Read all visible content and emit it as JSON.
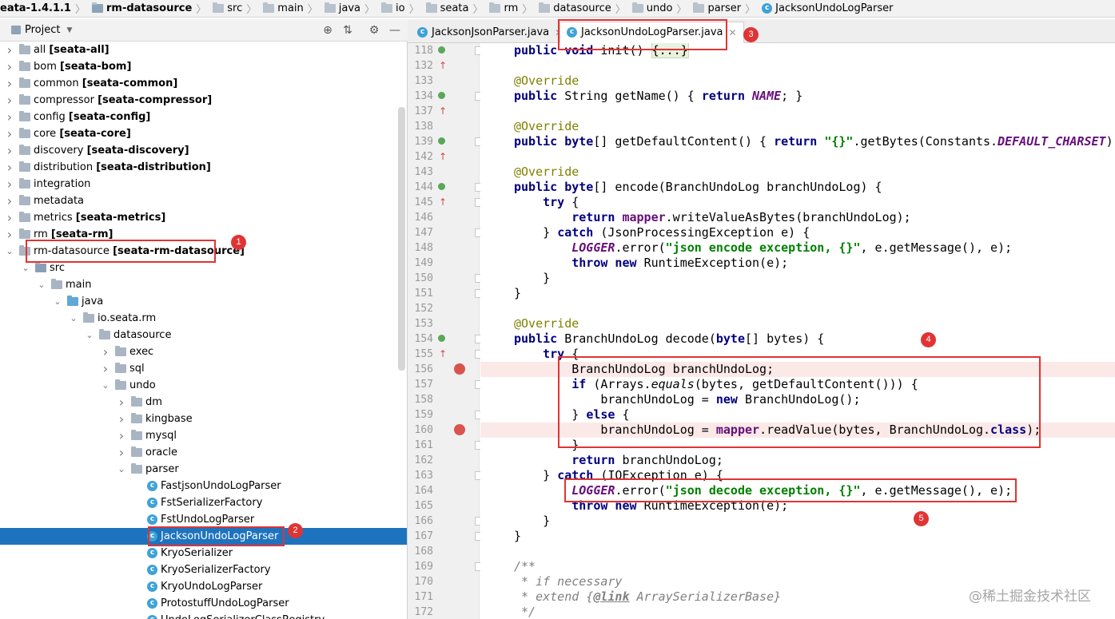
{
  "breadcrumb": [
    {
      "label": "eata-1.4.1.1",
      "bold": true,
      "icon": "folder-icon"
    },
    {
      "label": "rm-datasource",
      "bold": true,
      "icon": "module-folder-icon"
    },
    {
      "label": "src",
      "bold": false,
      "icon": "folder-icon"
    },
    {
      "label": "main",
      "bold": false,
      "icon": "folder-icon"
    },
    {
      "label": "java",
      "bold": false,
      "icon": "folder-icon"
    },
    {
      "label": "io",
      "bold": false,
      "icon": "folder-icon"
    },
    {
      "label": "seata",
      "bold": false,
      "icon": "folder-icon"
    },
    {
      "label": "rm",
      "bold": false,
      "icon": "folder-icon"
    },
    {
      "label": "datasource",
      "bold": false,
      "icon": "folder-icon"
    },
    {
      "label": "undo",
      "bold": false,
      "icon": "folder-icon"
    },
    {
      "label": "parser",
      "bold": false,
      "icon": "folder-icon"
    },
    {
      "label": "JacksonUndoLogParser",
      "bold": false,
      "icon": "class-icon"
    }
  ],
  "project_panel": {
    "title": "Project",
    "tree": [
      {
        "depth": 0,
        "arrow": "right",
        "icon": "module",
        "name": "all",
        "module": "[seata-all]"
      },
      {
        "depth": 0,
        "arrow": "right",
        "icon": "module",
        "name": "bom",
        "module": "[seata-bom]"
      },
      {
        "depth": 0,
        "arrow": "right",
        "icon": "module",
        "name": "common",
        "module": "[seata-common]"
      },
      {
        "depth": 0,
        "arrow": "right",
        "icon": "module",
        "name": "compressor",
        "module": "[seata-compressor]"
      },
      {
        "depth": 0,
        "arrow": "right",
        "icon": "module",
        "name": "config",
        "module": "[seata-config]"
      },
      {
        "depth": 0,
        "arrow": "right",
        "icon": "module",
        "name": "core",
        "module": "[seata-core]"
      },
      {
        "depth": 0,
        "arrow": "right",
        "icon": "module",
        "name": "discovery",
        "module": "[seata-discovery]"
      },
      {
        "depth": 0,
        "arrow": "right",
        "icon": "module",
        "name": "distribution",
        "module": "[seata-distribution]"
      },
      {
        "depth": 0,
        "arrow": "right",
        "icon": "folder",
        "name": "integration",
        "module": ""
      },
      {
        "depth": 0,
        "arrow": "right",
        "icon": "folder",
        "name": "metadata",
        "module": ""
      },
      {
        "depth": 0,
        "arrow": "right",
        "icon": "module",
        "name": "metrics",
        "module": "[seata-metrics]"
      },
      {
        "depth": 0,
        "arrow": "right",
        "icon": "module",
        "name": "rm",
        "module": "[seata-rm]"
      },
      {
        "depth": 0,
        "arrow": "down",
        "icon": "module",
        "name": "rm-datasource",
        "module": "[seata-rm-datasource]"
      },
      {
        "depth": 1,
        "arrow": "down",
        "icon": "src",
        "name": "src",
        "module": ""
      },
      {
        "depth": 2,
        "arrow": "down",
        "icon": "folder",
        "name": "main",
        "module": ""
      },
      {
        "depth": 3,
        "arrow": "down",
        "icon": "java",
        "name": "java",
        "module": ""
      },
      {
        "depth": 4,
        "arrow": "down",
        "icon": "pkg",
        "name": "io.seata.rm",
        "module": ""
      },
      {
        "depth": 5,
        "arrow": "down",
        "icon": "pkg",
        "name": "datasource",
        "module": ""
      },
      {
        "depth": 6,
        "arrow": "right",
        "icon": "pkg",
        "name": "exec",
        "module": ""
      },
      {
        "depth": 6,
        "arrow": "right",
        "icon": "pkg",
        "name": "sql",
        "module": ""
      },
      {
        "depth": 6,
        "arrow": "down",
        "icon": "pkg",
        "name": "undo",
        "module": ""
      },
      {
        "depth": 7,
        "arrow": "right",
        "icon": "pkg",
        "name": "dm",
        "module": ""
      },
      {
        "depth": 7,
        "arrow": "right",
        "icon": "pkg",
        "name": "kingbase",
        "module": ""
      },
      {
        "depth": 7,
        "arrow": "right",
        "icon": "pkg",
        "name": "mysql",
        "module": ""
      },
      {
        "depth": 7,
        "arrow": "right",
        "icon": "pkg",
        "name": "oracle",
        "module": ""
      },
      {
        "depth": 7,
        "arrow": "down",
        "icon": "pkg",
        "name": "parser",
        "module": ""
      },
      {
        "depth": 8,
        "arrow": "none",
        "icon": "class",
        "name": "FastjsonUndoLogParser",
        "module": ""
      },
      {
        "depth": 8,
        "arrow": "none",
        "icon": "class",
        "name": "FstSerializerFactory",
        "module": ""
      },
      {
        "depth": 8,
        "arrow": "none",
        "icon": "class",
        "name": "FstUndoLogParser",
        "module": ""
      },
      {
        "depth": 8,
        "arrow": "none",
        "icon": "class",
        "name": "JacksonUndoLogParser",
        "module": "",
        "selected": true
      },
      {
        "depth": 8,
        "arrow": "none",
        "icon": "class",
        "name": "KryoSerializer",
        "module": ""
      },
      {
        "depth": 8,
        "arrow": "none",
        "icon": "class",
        "name": "KryoSerializerFactory",
        "module": ""
      },
      {
        "depth": 8,
        "arrow": "none",
        "icon": "class",
        "name": "KryoUndoLogParser",
        "module": ""
      },
      {
        "depth": 8,
        "arrow": "none",
        "icon": "class",
        "name": "ProtostuffUndoLogParser",
        "module": ""
      },
      {
        "depth": 8,
        "arrow": "none",
        "icon": "class",
        "name": "UndoLogSerializerClassRegistry",
        "module": ""
      }
    ]
  },
  "editor": {
    "tabs": [
      {
        "label": "JacksonJsonParser.java",
        "active": false
      },
      {
        "label": "JacksonUndoLogParser.java",
        "active": true
      }
    ],
    "lines": [
      {
        "n": "118",
        "impl": true,
        "bp": false,
        "fold": true,
        "code": [
          [
            "kw",
            "public "
          ],
          [
            "kw",
            "void "
          ],
          [
            "pl",
            "init() "
          ],
          [
            "fold",
            "{...}"
          ]
        ]
      },
      {
        "n": "132",
        "impl": false,
        "bp": false,
        "fold": false,
        "code": []
      },
      {
        "n": "133",
        "impl": false,
        "bp": false,
        "fold": false,
        "code": [
          [
            "an",
            "@Override"
          ]
        ]
      },
      {
        "n": "134",
        "impl": true,
        "bp": false,
        "fold": true,
        "code": [
          [
            "kw",
            "public "
          ],
          [
            "pl",
            "String getName() { "
          ],
          [
            "kw",
            "return "
          ],
          [
            "const",
            "NAME"
          ],
          [
            "pl",
            "; }"
          ]
        ]
      },
      {
        "n": "137",
        "impl": false,
        "bp": false,
        "fold": false,
        "code": []
      },
      {
        "n": "138",
        "impl": false,
        "bp": false,
        "fold": false,
        "code": [
          [
            "an",
            "@Override"
          ]
        ]
      },
      {
        "n": "139",
        "impl": true,
        "bp": false,
        "fold": true,
        "code": [
          [
            "kw",
            "public byte"
          ],
          [
            "pl",
            "[] getDefaultContent() { "
          ],
          [
            "kw",
            "return "
          ],
          [
            "str",
            "\"{}\""
          ],
          [
            "pl",
            ".getBytes(Constants."
          ],
          [
            "const",
            "DEFAULT_CHARSET"
          ],
          [
            "pl",
            ");"
          ]
        ]
      },
      {
        "n": "142",
        "impl": false,
        "bp": false,
        "fold": false,
        "code": []
      },
      {
        "n": "143",
        "impl": false,
        "bp": false,
        "fold": false,
        "code": [
          [
            "an",
            "@Override"
          ]
        ]
      },
      {
        "n": "144",
        "impl": true,
        "bp": false,
        "fold": true,
        "code": [
          [
            "kw",
            "public byte"
          ],
          [
            "pl",
            "[] encode(BranchUndoLog branchUndoLog) {"
          ]
        ]
      },
      {
        "n": "145",
        "impl": false,
        "bp": false,
        "fold": true,
        "code": [
          [
            "pl",
            "    "
          ],
          [
            "kw",
            "try "
          ],
          [
            "pl",
            "{"
          ]
        ]
      },
      {
        "n": "146",
        "impl": false,
        "bp": false,
        "fold": false,
        "code": [
          [
            "pl",
            "        "
          ],
          [
            "kw",
            "return "
          ],
          [
            "field",
            "mapper"
          ],
          [
            "pl",
            ".writeValueAsBytes(branchUndoLog);"
          ]
        ]
      },
      {
        "n": "147",
        "impl": false,
        "bp": false,
        "fold": true,
        "code": [
          [
            "pl",
            "    } "
          ],
          [
            "kw",
            "catch "
          ],
          [
            "pl",
            "(JsonProcessingException e) {"
          ]
        ]
      },
      {
        "n": "148",
        "impl": false,
        "bp": false,
        "fold": false,
        "code": [
          [
            "pl",
            "        "
          ],
          [
            "const",
            "LOGGER"
          ],
          [
            "pl",
            ".error("
          ],
          [
            "str",
            "\"json encode exception, {}\""
          ],
          [
            "pl",
            ", e.getMessage(), e);"
          ]
        ]
      },
      {
        "n": "149",
        "impl": false,
        "bp": false,
        "fold": false,
        "code": [
          [
            "pl",
            "        "
          ],
          [
            "kw",
            "throw new "
          ],
          [
            "pl",
            "RuntimeException(e);"
          ]
        ]
      },
      {
        "n": "150",
        "impl": false,
        "bp": false,
        "fold": true,
        "code": [
          [
            "pl",
            "    }"
          ]
        ]
      },
      {
        "n": "151",
        "impl": false,
        "bp": false,
        "fold": true,
        "code": [
          [
            "pl",
            "}"
          ]
        ]
      },
      {
        "n": "152",
        "impl": false,
        "bp": false,
        "fold": false,
        "code": []
      },
      {
        "n": "153",
        "impl": false,
        "bp": false,
        "fold": false,
        "code": [
          [
            "an",
            "@Override"
          ]
        ]
      },
      {
        "n": "154",
        "impl": true,
        "bp": false,
        "fold": true,
        "code": [
          [
            "kw",
            "public "
          ],
          [
            "pl",
            "BranchUndoLog decode("
          ],
          [
            "kw",
            "byte"
          ],
          [
            "pl",
            "[] bytes) {"
          ]
        ]
      },
      {
        "n": "155",
        "impl": false,
        "bp": false,
        "fold": true,
        "code": [
          [
            "pl",
            "    "
          ],
          [
            "kw",
            "try "
          ],
          [
            "pl",
            "{"
          ]
        ]
      },
      {
        "n": "156",
        "impl": false,
        "bp": true,
        "fold": false,
        "code": [
          [
            "pl",
            "        BranchUndoLog branchUndoLog;"
          ]
        ]
      },
      {
        "n": "157",
        "impl": false,
        "bp": false,
        "fold": true,
        "code": [
          [
            "pl",
            "        "
          ],
          [
            "kw",
            "if "
          ],
          [
            "pl",
            "(Arrays."
          ],
          [
            "static",
            "equals"
          ],
          [
            "pl",
            "(bytes, getDefaultContent())) {"
          ]
        ]
      },
      {
        "n": "158",
        "impl": false,
        "bp": false,
        "fold": false,
        "code": [
          [
            "pl",
            "            branchUndoLog = "
          ],
          [
            "kw",
            "new "
          ],
          [
            "pl",
            "BranchUndoLog();"
          ]
        ]
      },
      {
        "n": "159",
        "impl": false,
        "bp": false,
        "fold": true,
        "code": [
          [
            "pl",
            "        } "
          ],
          [
            "kw",
            "else "
          ],
          [
            "pl",
            "{"
          ]
        ]
      },
      {
        "n": "160",
        "impl": false,
        "bp": true,
        "fold": false,
        "code": [
          [
            "pl",
            "            branchUndoLog = "
          ],
          [
            "field",
            "mapper"
          ],
          [
            "pl",
            ".readValue(bytes, BranchUndoLog."
          ],
          [
            "kw",
            "class"
          ],
          [
            "pl",
            ");"
          ]
        ]
      },
      {
        "n": "161",
        "impl": false,
        "bp": false,
        "fold": true,
        "code": [
          [
            "pl",
            "        }"
          ]
        ]
      },
      {
        "n": "162",
        "impl": false,
        "bp": false,
        "fold": false,
        "code": [
          [
            "pl",
            "        "
          ],
          [
            "kw",
            "return "
          ],
          [
            "pl",
            "branchUndoLog;"
          ]
        ]
      },
      {
        "n": "163",
        "impl": false,
        "bp": false,
        "fold": true,
        "code": [
          [
            "pl",
            "    } "
          ],
          [
            "kw",
            "catch "
          ],
          [
            "pl",
            "(IOException e) {"
          ]
        ]
      },
      {
        "n": "164",
        "impl": false,
        "bp": false,
        "fold": false,
        "code": [
          [
            "pl",
            "        "
          ],
          [
            "const",
            "LOGGER"
          ],
          [
            "pl",
            ".error("
          ],
          [
            "str",
            "\"json decode exception, {}\""
          ],
          [
            "pl",
            ", e.getMessage(), e);"
          ]
        ]
      },
      {
        "n": "165",
        "impl": false,
        "bp": false,
        "fold": false,
        "code": [
          [
            "pl",
            "        "
          ],
          [
            "kw",
            "throw new "
          ],
          [
            "pl",
            "RuntimeException(e);"
          ]
        ]
      },
      {
        "n": "166",
        "impl": false,
        "bp": false,
        "fold": true,
        "code": [
          [
            "pl",
            "    }"
          ]
        ]
      },
      {
        "n": "167",
        "impl": false,
        "bp": false,
        "fold": true,
        "code": [
          [
            "pl",
            "}"
          ]
        ]
      },
      {
        "n": "168",
        "impl": false,
        "bp": false,
        "fold": false,
        "code": []
      },
      {
        "n": "169",
        "impl": false,
        "bp": false,
        "fold": true,
        "code": [
          [
            "cm",
            "/**"
          ]
        ]
      },
      {
        "n": "170",
        "impl": false,
        "bp": false,
        "fold": false,
        "code": [
          [
            "cm",
            " * if necessary"
          ]
        ]
      },
      {
        "n": "171",
        "impl": false,
        "bp": false,
        "fold": false,
        "code": [
          [
            "cm",
            " * extend {"
          ],
          [
            "cmtag",
            "@link"
          ],
          [
            "cm",
            " ArraySerializerBase}"
          ]
        ]
      },
      {
        "n": "172",
        "impl": false,
        "bp": false,
        "fold": false,
        "code": [
          [
            "cm",
            " */"
          ]
        ]
      }
    ]
  },
  "annotations": [
    "1",
    "2",
    "3",
    "4",
    "5"
  ],
  "watermark": "@稀土掘金技术社区",
  "colors": {
    "keyword": "#000080",
    "string": "#008000",
    "annotation": "#808000",
    "constant": "#660e7a",
    "comment": "#808080",
    "annot_red": "#e03434",
    "selection": "#1e73be"
  }
}
